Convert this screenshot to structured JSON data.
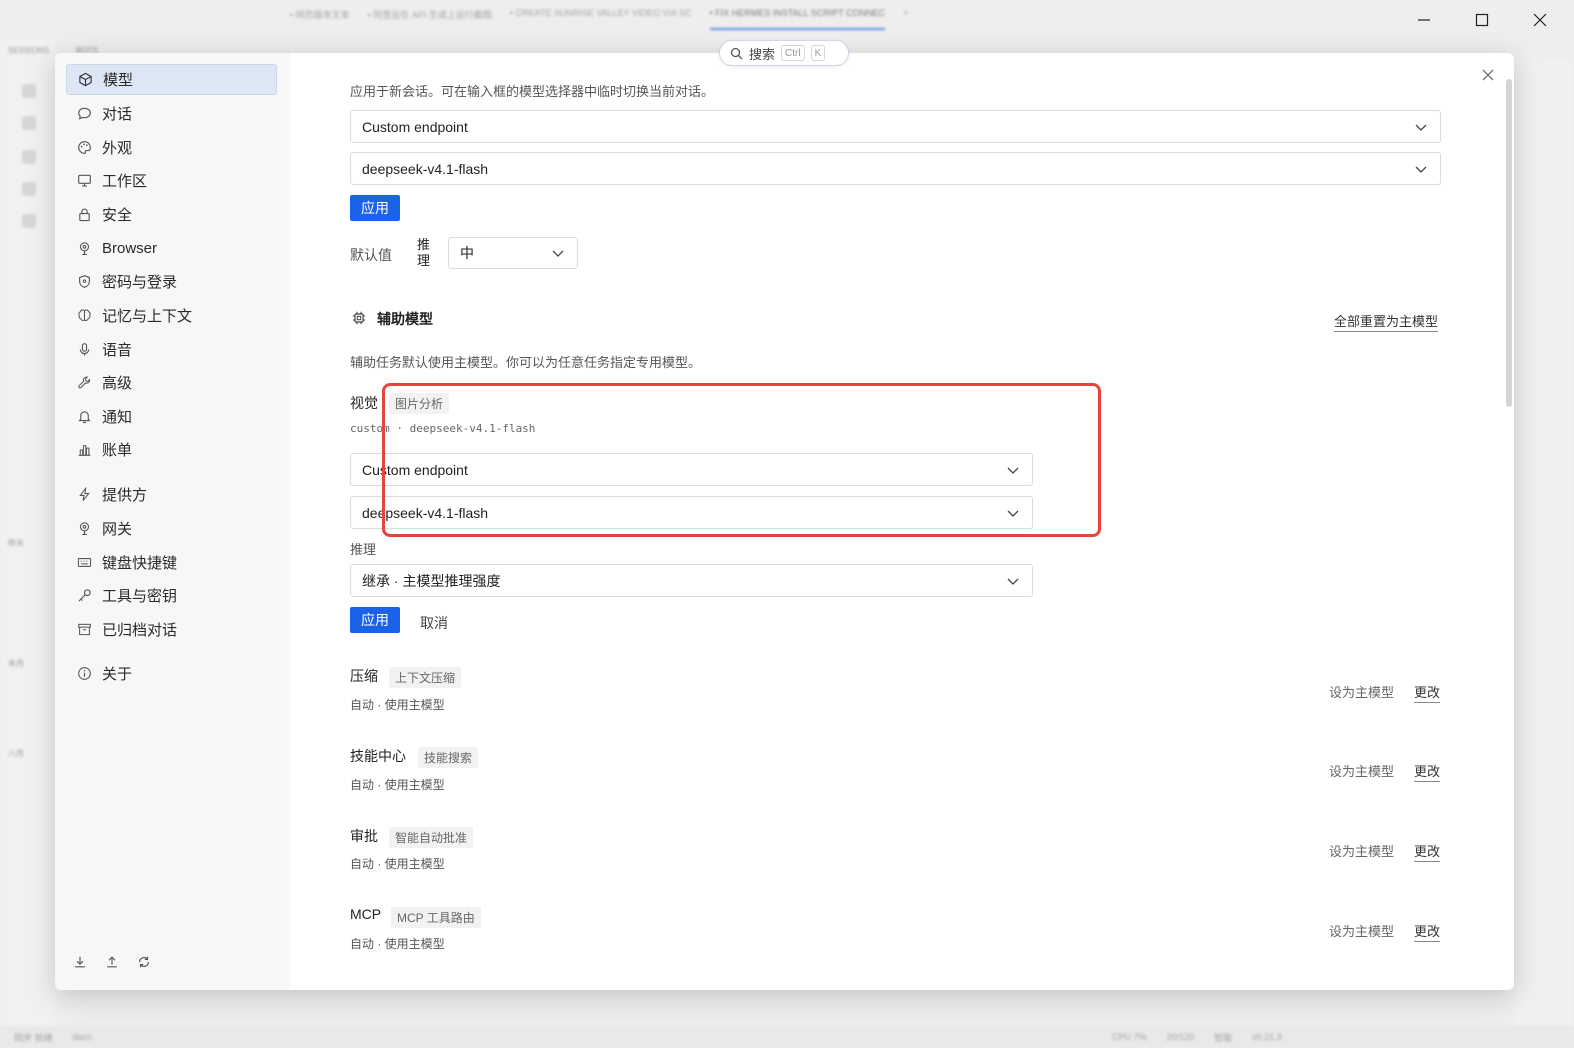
{
  "background": {
    "tabs": [
      "• 网页版本文本",
      "• 阿里云在 API 生成上运行截图",
      "• CREATE SUNRISE VALLEY VIDEO VIA SC",
      "• FIX HERMES INSTALL SCRIPT CONNEC",
      "+"
    ],
    "sidebar_labels": [
      "SESSIONS",
      "BOTS",
      "昨天",
      "本月",
      "八月"
    ],
    "status": [
      "同步 就绪",
      "dacn",
      "CPU 7%",
      "20/120",
      "智能",
      "v0.21.3"
    ]
  },
  "search": {
    "label": "搜索",
    "key1": "Ctrl",
    "key2": "K"
  },
  "nav": {
    "items": [
      {
        "label": "模型",
        "icon": "cube-icon"
      },
      {
        "label": "对话",
        "icon": "chat-bubble-icon"
      },
      {
        "label": "外观",
        "icon": "palette-icon"
      },
      {
        "label": "工作区",
        "icon": "monitor-icon"
      },
      {
        "label": "安全",
        "icon": "lock-icon"
      },
      {
        "label": "Browser",
        "icon": "globe-pin-icon"
      },
      {
        "label": "密码与登录",
        "icon": "shield-icon"
      },
      {
        "label": "记忆与上下文",
        "icon": "brain-icon"
      },
      {
        "label": "语音",
        "icon": "microphone-icon"
      },
      {
        "label": "高级",
        "icon": "wrench-icon"
      },
      {
        "label": "通知",
        "icon": "bell-icon"
      },
      {
        "label": "账单",
        "icon": "bar-chart-icon"
      },
      {
        "label": "提供方",
        "icon": "lightning-icon"
      },
      {
        "label": "网关",
        "icon": "gateway-icon"
      },
      {
        "label": "键盘快捷键",
        "icon": "keyboard-icon"
      },
      {
        "label": "工具与密钥",
        "icon": "key-icon"
      },
      {
        "label": "已归档对话",
        "icon": "archive-icon"
      },
      {
        "label": "关于",
        "icon": "info-icon"
      }
    ]
  },
  "main": {
    "intro": "应用于新会话。可在输入框的模型选择器中临时切换当前对话。",
    "provider_value": "Custom endpoint",
    "model_value": "deepseek-v4.1-flash",
    "apply_label": "应用",
    "default_label": "默认值",
    "reasoning_label": "推理",
    "reasoning_value": "中"
  },
  "aux": {
    "title": "辅助模型",
    "reset_all": "全部重置为主模型",
    "desc": "辅助任务默认使用主模型。你可以为任意任务指定专用模型。",
    "vision": {
      "title": "视觉",
      "tag": "图片分析",
      "current": "custom · deepseek-v4.1-flash",
      "provider": "Custom endpoint",
      "model": "deepseek-v4.1-flash",
      "reasoning_label": "推理",
      "reasoning_value": "继承 · 主模型推理强度",
      "apply": "应用",
      "cancel": "取消"
    },
    "tasks": [
      {
        "title": "压缩",
        "tag": "上下文压缩",
        "status": "自动 · 使用主模型",
        "set_main": "设为主模型",
        "change": "更改"
      },
      {
        "title": "技能中心",
        "tag": "技能搜索",
        "status": "自动 · 使用主模型",
        "set_main": "设为主模型",
        "change": "更改"
      },
      {
        "title": "审批",
        "tag": "智能自动批准",
        "status": "自动 · 使用主模型",
        "set_main": "设为主模型",
        "change": "更改"
      },
      {
        "title": "MCP",
        "tag": "MCP 工具路由",
        "status": "自动 · 使用主模型",
        "set_main": "设为主模型",
        "change": "更改"
      }
    ]
  }
}
